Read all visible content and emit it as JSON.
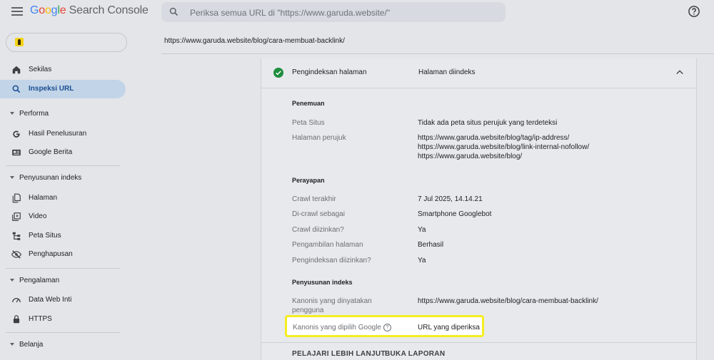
{
  "app": {
    "logo_google": "Google",
    "logo_product": "Search Console"
  },
  "search": {
    "placeholder": "Periksa semua URL di \"https://www.garuda.website/\""
  },
  "sidebar": {
    "items_top": [
      {
        "label": "Sekilas",
        "icon": "home-icon"
      },
      {
        "label": "Inspeksi URL",
        "icon": "search-icon"
      }
    ],
    "sections": [
      {
        "title": "Performa",
        "items": [
          {
            "label": "Hasil Penelusuran",
            "icon": "google-g-icon"
          },
          {
            "label": "Google Berita",
            "icon": "news-icon"
          }
        ]
      },
      {
        "title": "Penyusunan indeks",
        "items": [
          {
            "label": "Halaman",
            "icon": "pages-icon"
          },
          {
            "label": "Video",
            "icon": "video-icon"
          },
          {
            "label": "Peta Situs",
            "icon": "sitemap-icon"
          },
          {
            "label": "Penghapusan",
            "icon": "removal-icon"
          }
        ]
      },
      {
        "title": "Pengalaman",
        "items": [
          {
            "label": "Data Web Inti",
            "icon": "speed-icon"
          },
          {
            "label": "HTTPS",
            "icon": "lock-icon"
          }
        ]
      },
      {
        "title": "Belanja",
        "items": []
      }
    ]
  },
  "inspected_url": "https://www.garuda.website/blog/cara-membuat-backlink/",
  "card": {
    "header_title": "Pengindeksan halaman",
    "header_status": "Halaman diindeks",
    "discovery": {
      "title": "Penemuan",
      "sitemap_label": "Peta Situs",
      "sitemap_value": "Tidak ada peta situs perujuk yang terdeteksi",
      "referrer_label": "Halaman perujuk",
      "referrers": [
        "https://www.garuda.website/blog/tag/ip-address/",
        "https://www.garuda.website/blog/link-internal-nofollow/",
        "https://www.garuda.website/blog/"
      ]
    },
    "crawl": {
      "title": "Perayapan",
      "rows": [
        {
          "label": "Crawl terakhir",
          "value": "7 Jul 2025, 14.14.21"
        },
        {
          "label": "Di-crawl sebagai",
          "value": "Smartphone Googlebot"
        },
        {
          "label": "Crawl diizinkan?",
          "value": "Ya"
        },
        {
          "label": "Pengambilan halaman",
          "value": "Berhasil"
        },
        {
          "label": "Pengindeksan diizinkan?",
          "value": "Ya"
        }
      ]
    },
    "indexing": {
      "title": "Penyusunan indeks",
      "declared_label_1": "Kanonis yang dinyatakan",
      "declared_label_2": "pengguna",
      "declared_value": "https://www.garuda.website/blog/cara-membuat-backlink/",
      "google_label": "Kanonis yang dipilih Google",
      "google_value": "URL yang diperiksa"
    },
    "footer": {
      "learn_more": "PELAJARI LEBIH LANJUT",
      "open_report": "BUKA LAPORAN"
    }
  },
  "colors": {
    "highlight": "#f5ee20",
    "check_green": "#1e8e3e",
    "active_nav": "#c2d4e8"
  }
}
